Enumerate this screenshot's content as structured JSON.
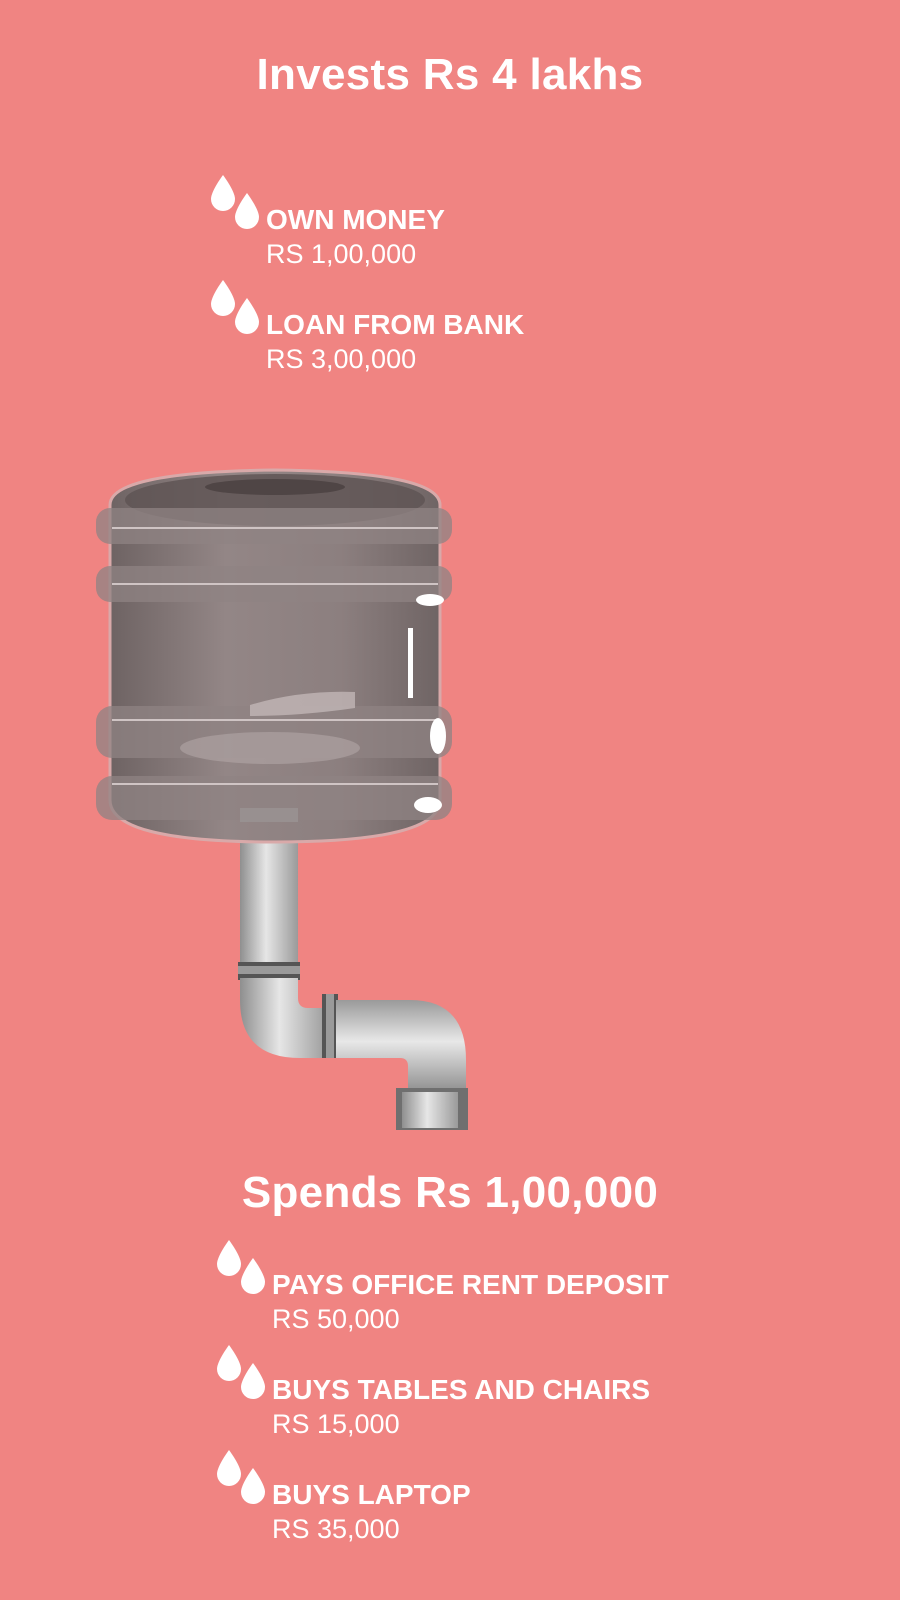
{
  "invest": {
    "title": "Invests Rs 4 lakhs",
    "items": [
      {
        "label": "OWN MONEY",
        "value": "RS 1,00,000"
      },
      {
        "label": "LOAN FROM BANK",
        "value": "RS 3,00,000"
      }
    ]
  },
  "spend": {
    "title": "Spends Rs 1,00,000",
    "items": [
      {
        "label": "PAYS OFFICE RENT DEPOSIT",
        "value": "RS 50,000"
      },
      {
        "label": "BUYS TABLES AND CHAIRS",
        "value": "RS 15,000"
      },
      {
        "label": "BUYS LAPTOP",
        "value": "RS 35,000"
      }
    ]
  },
  "colors": {
    "background": "#f08482",
    "text": "#ffffff",
    "tank": "#8a7c7c",
    "pipe": "#b8b8b8"
  },
  "icons": [
    "water-drop-icon",
    "water-tank-icon",
    "pipe-icon"
  ]
}
